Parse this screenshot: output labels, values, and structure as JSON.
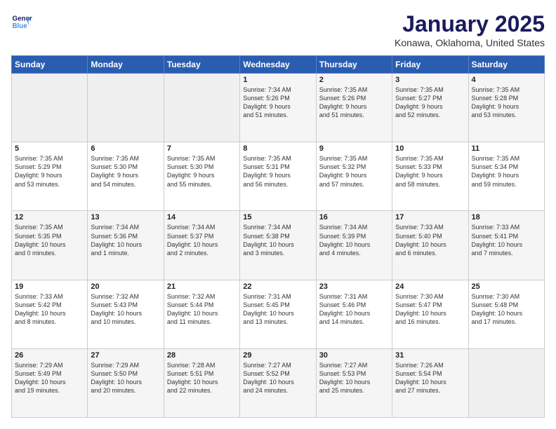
{
  "header": {
    "logo_line1": "General",
    "logo_line2": "Blue",
    "month": "January 2025",
    "location": "Konawa, Oklahoma, United States"
  },
  "weekdays": [
    "Sunday",
    "Monday",
    "Tuesday",
    "Wednesday",
    "Thursday",
    "Friday",
    "Saturday"
  ],
  "weeks": [
    [
      {
        "day": "",
        "info": "",
        "empty": true
      },
      {
        "day": "",
        "info": "",
        "empty": true
      },
      {
        "day": "",
        "info": "",
        "empty": true
      },
      {
        "day": "1",
        "info": "Sunrise: 7:34 AM\nSunset: 5:26 PM\nDaylight: 9 hours\nand 51 minutes."
      },
      {
        "day": "2",
        "info": "Sunrise: 7:35 AM\nSunset: 5:26 PM\nDaylight: 9 hours\nand 51 minutes."
      },
      {
        "day": "3",
        "info": "Sunrise: 7:35 AM\nSunset: 5:27 PM\nDaylight: 9 hours\nand 52 minutes."
      },
      {
        "day": "4",
        "info": "Sunrise: 7:35 AM\nSunset: 5:28 PM\nDaylight: 9 hours\nand 53 minutes."
      }
    ],
    [
      {
        "day": "5",
        "info": "Sunrise: 7:35 AM\nSunset: 5:29 PM\nDaylight: 9 hours\nand 53 minutes."
      },
      {
        "day": "6",
        "info": "Sunrise: 7:35 AM\nSunset: 5:30 PM\nDaylight: 9 hours\nand 54 minutes."
      },
      {
        "day": "7",
        "info": "Sunrise: 7:35 AM\nSunset: 5:30 PM\nDaylight: 9 hours\nand 55 minutes."
      },
      {
        "day": "8",
        "info": "Sunrise: 7:35 AM\nSunset: 5:31 PM\nDaylight: 9 hours\nand 56 minutes."
      },
      {
        "day": "9",
        "info": "Sunrise: 7:35 AM\nSunset: 5:32 PM\nDaylight: 9 hours\nand 57 minutes."
      },
      {
        "day": "10",
        "info": "Sunrise: 7:35 AM\nSunset: 5:33 PM\nDaylight: 9 hours\nand 58 minutes."
      },
      {
        "day": "11",
        "info": "Sunrise: 7:35 AM\nSunset: 5:34 PM\nDaylight: 9 hours\nand 59 minutes."
      }
    ],
    [
      {
        "day": "12",
        "info": "Sunrise: 7:35 AM\nSunset: 5:35 PM\nDaylight: 10 hours\nand 0 minutes."
      },
      {
        "day": "13",
        "info": "Sunrise: 7:34 AM\nSunset: 5:36 PM\nDaylight: 10 hours\nand 1 minute."
      },
      {
        "day": "14",
        "info": "Sunrise: 7:34 AM\nSunset: 5:37 PM\nDaylight: 10 hours\nand 2 minutes."
      },
      {
        "day": "15",
        "info": "Sunrise: 7:34 AM\nSunset: 5:38 PM\nDaylight: 10 hours\nand 3 minutes."
      },
      {
        "day": "16",
        "info": "Sunrise: 7:34 AM\nSunset: 5:39 PM\nDaylight: 10 hours\nand 4 minutes."
      },
      {
        "day": "17",
        "info": "Sunrise: 7:33 AM\nSunset: 5:40 PM\nDaylight: 10 hours\nand 6 minutes."
      },
      {
        "day": "18",
        "info": "Sunrise: 7:33 AM\nSunset: 5:41 PM\nDaylight: 10 hours\nand 7 minutes."
      }
    ],
    [
      {
        "day": "19",
        "info": "Sunrise: 7:33 AM\nSunset: 5:42 PM\nDaylight: 10 hours\nand 8 minutes."
      },
      {
        "day": "20",
        "info": "Sunrise: 7:32 AM\nSunset: 5:43 PM\nDaylight: 10 hours\nand 10 minutes."
      },
      {
        "day": "21",
        "info": "Sunrise: 7:32 AM\nSunset: 5:44 PM\nDaylight: 10 hours\nand 11 minutes."
      },
      {
        "day": "22",
        "info": "Sunrise: 7:31 AM\nSunset: 5:45 PM\nDaylight: 10 hours\nand 13 minutes."
      },
      {
        "day": "23",
        "info": "Sunrise: 7:31 AM\nSunset: 5:46 PM\nDaylight: 10 hours\nand 14 minutes."
      },
      {
        "day": "24",
        "info": "Sunrise: 7:30 AM\nSunset: 5:47 PM\nDaylight: 10 hours\nand 16 minutes."
      },
      {
        "day": "25",
        "info": "Sunrise: 7:30 AM\nSunset: 5:48 PM\nDaylight: 10 hours\nand 17 minutes."
      }
    ],
    [
      {
        "day": "26",
        "info": "Sunrise: 7:29 AM\nSunset: 5:49 PM\nDaylight: 10 hours\nand 19 minutes."
      },
      {
        "day": "27",
        "info": "Sunrise: 7:29 AM\nSunset: 5:50 PM\nDaylight: 10 hours\nand 20 minutes."
      },
      {
        "day": "28",
        "info": "Sunrise: 7:28 AM\nSunset: 5:51 PM\nDaylight: 10 hours\nand 22 minutes."
      },
      {
        "day": "29",
        "info": "Sunrise: 7:27 AM\nSunset: 5:52 PM\nDaylight: 10 hours\nand 24 minutes."
      },
      {
        "day": "30",
        "info": "Sunrise: 7:27 AM\nSunset: 5:53 PM\nDaylight: 10 hours\nand 25 minutes."
      },
      {
        "day": "31",
        "info": "Sunrise: 7:26 AM\nSunset: 5:54 PM\nDaylight: 10 hours\nand 27 minutes."
      },
      {
        "day": "",
        "info": "",
        "empty": true
      }
    ]
  ]
}
